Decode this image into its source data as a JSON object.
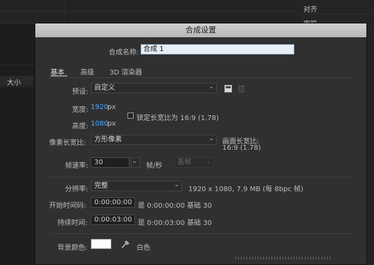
{
  "background": {
    "right_panel": {
      "item1": "对齐",
      "item2": "字符"
    },
    "left_panel": {
      "size_label": "大小"
    }
  },
  "dialog": {
    "title": "合成设置",
    "comp_name_label": "合成名称:",
    "comp_name_value": "合成 1",
    "tabs": [
      "基本",
      "高级",
      "3D 渲染器"
    ],
    "preset_label": "预设:",
    "preset_value": "自定义",
    "width_label": "宽度:",
    "width_value": "1920",
    "width_unit": "px",
    "height_label": "高度:",
    "height_value": "1080",
    "height_unit": "px",
    "lock_aspect_label": "锁定长宽比为 16:9 (1.78)",
    "pixel_aspect_label": "像素长宽比:",
    "pixel_aspect_value": "方形像素",
    "frame_aspect_label": "画面长宽比:",
    "frame_aspect_value": "16:9 (1.78)",
    "frame_rate_label": "帧速率:",
    "frame_rate_value": "30",
    "frame_rate_unit": "帧/秒",
    "drop_frame_value": "丢帧",
    "resolution_label": "分辨率:",
    "resolution_value": "完整",
    "resolution_info": "1920 x 1080, 7.9 MB (每 8bpc 帧)",
    "start_timecode_label": "开始时间码:",
    "start_timecode_value": "0:00:00:00",
    "start_timecode_info": "是 0:00:00:00  基础 30",
    "duration_label": "持续时间:",
    "duration_value": "0:00:03:00",
    "duration_info": "是 0:00:03:00  基础 30",
    "bg_color_label": "背景颜色:",
    "bg_color_name": "白色",
    "bg_color_hex": "#ffffff"
  }
}
